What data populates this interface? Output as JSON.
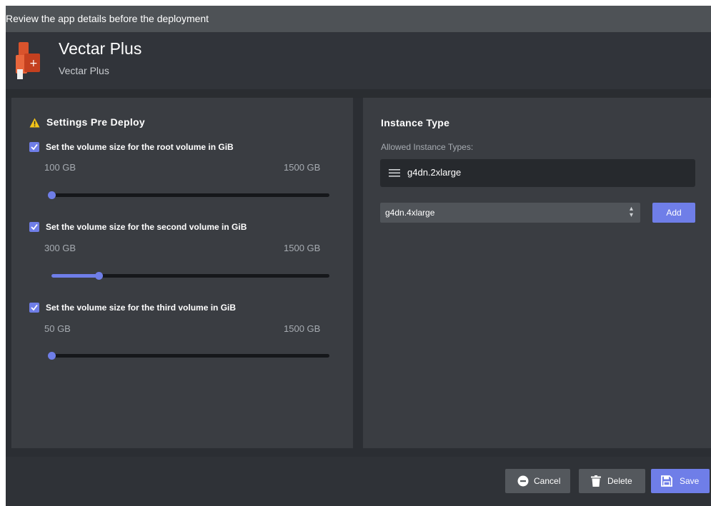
{
  "dialog": {
    "title": "Review the app details before the deployment"
  },
  "app": {
    "name": "Vectar Plus",
    "subtitle": "Vectar Plus",
    "logo_icon": "vectar-logo-icon"
  },
  "settings": {
    "title": "Settings Pre Deploy",
    "icon": "warning-icon",
    "volumes": [
      {
        "label": "Set the volume size for the root volume in GiB",
        "checked": true,
        "value_label": "100 GB",
        "max_label": "1500 GB",
        "fraction": 0.0
      },
      {
        "label": "Set the volume size for the second volume in GiB",
        "checked": true,
        "value_label": "300 GB",
        "max_label": "1500 GB",
        "fraction": 0.17
      },
      {
        "label": "Set the volume size for the third volume in GiB",
        "checked": true,
        "value_label": "50 GB",
        "max_label": "1500 GB",
        "fraction": 0.0
      }
    ]
  },
  "instance": {
    "title": "Instance Type",
    "allowed_label": "Allowed Instance Types:",
    "allowed": [
      "g4dn.2xlarge"
    ],
    "select_value": "g4dn.4xlarge",
    "add_label": "Add"
  },
  "footer": {
    "cancel_label": "Cancel",
    "delete_label": "Delete",
    "save_label": "Save"
  },
  "colors": {
    "accent": "#6f7ee8",
    "panel": "#3a3d42",
    "warning": "#f5c518"
  }
}
